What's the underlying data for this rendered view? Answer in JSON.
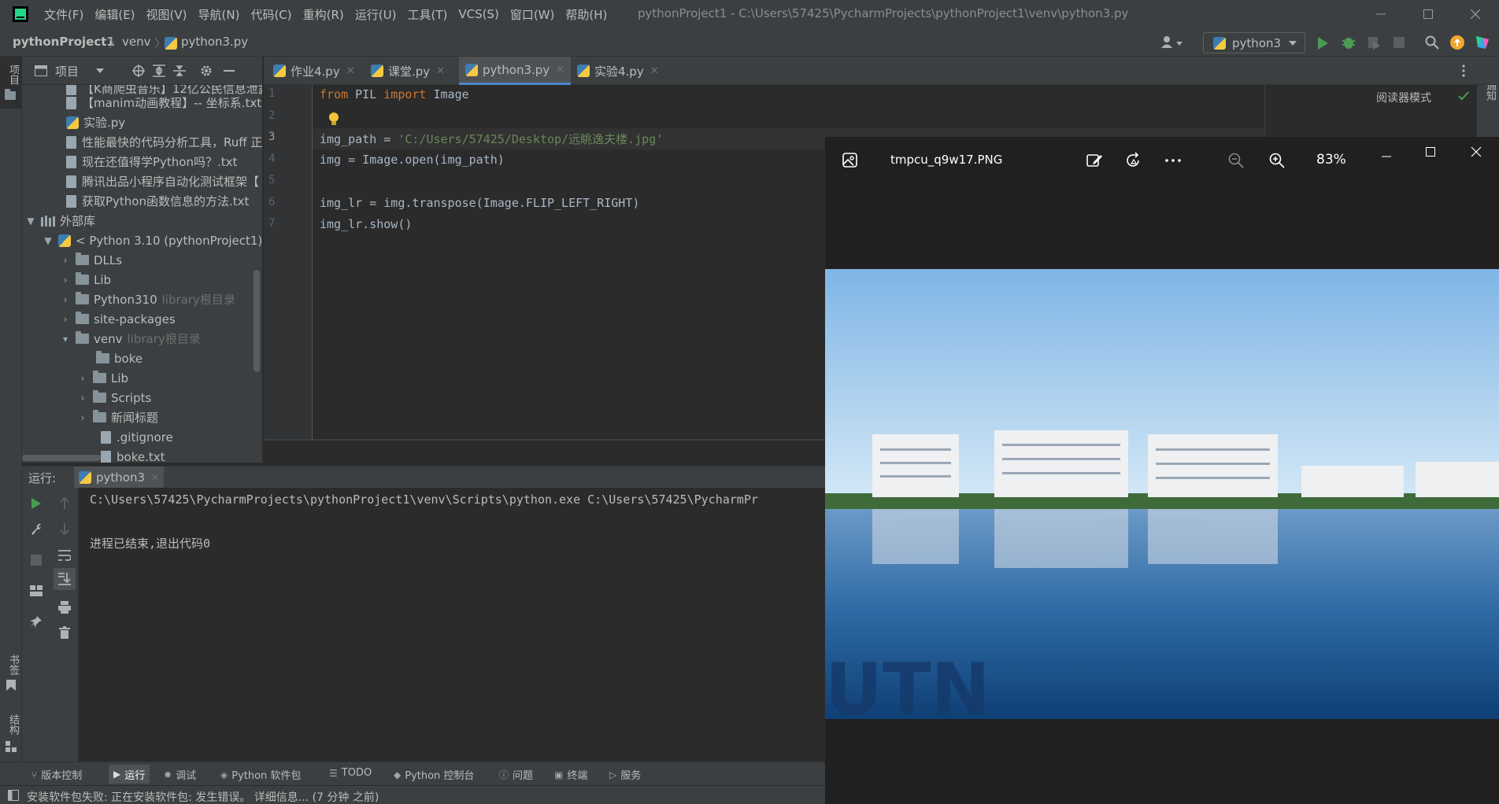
{
  "titlebar": {
    "menu": [
      "文件(F)",
      "编辑(E)",
      "视图(V)",
      "导航(N)",
      "代码(C)",
      "重构(R)",
      "运行(U)",
      "工具(T)",
      "VCS(S)",
      "窗口(W)",
      "帮助(H)"
    ],
    "window_title": "pythonProject1 - C:\\Users\\57425\\PycharmProjects\\pythonProject1\\venv\\python3.py"
  },
  "navbar": {
    "project": "pythonProject1",
    "folder": "venv",
    "file": "python3.py",
    "run_config": "python3"
  },
  "left_stripe": {
    "project_label": "项目",
    "bookmarks_label": "书签",
    "structure_label": "结构"
  },
  "right_stripe": {
    "notifications_label": "通知"
  },
  "project_panel": {
    "title": "项目",
    "tree": [
      {
        "label": "【K商爬虫音乐】12亿公民信息泄露",
        "type": "file"
      },
      {
        "label": "【manim动画教程】-- 坐标系.txt",
        "type": "file"
      },
      {
        "label": "实验.py",
        "type": "py"
      },
      {
        "label": "性能最快的代码分析工具，Ruff 正",
        "type": "file"
      },
      {
        "label": "现在还值得学Python吗？.txt",
        "type": "file"
      },
      {
        "label": "腾讯出品小程序自动化测试框架【",
        "type": "file"
      },
      {
        "label": "获取Python函数信息的方法.txt",
        "type": "file"
      },
      {
        "label": "外部库",
        "type": "lib"
      },
      {
        "label": "< Python 3.10 (pythonProject1)",
        "type": "sdk"
      },
      {
        "label": "DLLs",
        "type": "folder"
      },
      {
        "label": "Lib",
        "type": "folder"
      },
      {
        "label": "Python310",
        "hint": "library根目录",
        "type": "folder"
      },
      {
        "label": "site-packages",
        "type": "folder"
      },
      {
        "label": "venv",
        "hint": "library根目录",
        "type": "folder"
      },
      {
        "label": "boke",
        "type": "folder"
      },
      {
        "label": "Lib",
        "type": "folder"
      },
      {
        "label": "Scripts",
        "type": "folder"
      },
      {
        "label": "新闻标题",
        "type": "folder"
      },
      {
        "label": ".gitignore",
        "type": "file"
      },
      {
        "label": "boke.txt",
        "type": "file"
      }
    ]
  },
  "editor": {
    "tabs": [
      "作业4.py",
      "课堂.py",
      "python3.py",
      "实验4.py"
    ],
    "active_tab": "python3.py",
    "reader_mode": "阅读器模式",
    "line_numbers": [
      "1",
      "2",
      "3",
      "4",
      "5",
      "6",
      "7"
    ],
    "code": {
      "l1_kw1": "from",
      "l1_mod": " PIL ",
      "l1_kw2": "import",
      "l1_name": " Image",
      "l3_lhs": "img_path = ",
      "l3_str": "'C:/Users/57425/Desktop/远眺逸夫楼.jpg'",
      "l4": "img = Image.open(img_path)",
      "l6": "img_lr = img.transpose(Image.FLIP_LEFT_RIGHT)",
      "l7": "img_lr.show()"
    }
  },
  "run_window": {
    "label": "运行:",
    "tab": "python3",
    "output_line1": "C:\\Users\\57425\\PycharmProjects\\pythonProject1\\venv\\Scripts\\python.exe C:\\Users\\57425\\PycharmPr",
    "output_line2": "进程已结束,退出代码0"
  },
  "bottom_tools": [
    "版本控制",
    "运行",
    "调试",
    "Python 软件包",
    "TODO",
    "Python 控制台",
    "问题",
    "终端",
    "服务"
  ],
  "status": {
    "message": "安装软件包失败: 正在安装软件包: 发生错误。 详细信息... (7 分钟 之前)"
  },
  "photo_viewer": {
    "filename": "tmpcu_q9w17.PNG",
    "zoom": "83%",
    "watermark": "UTN"
  },
  "colors": {
    "bg": "#2b2b2b",
    "panel": "#3c3f41",
    "keyword": "#cc7832",
    "string": "#6a8759",
    "run_green": "#499c54"
  }
}
